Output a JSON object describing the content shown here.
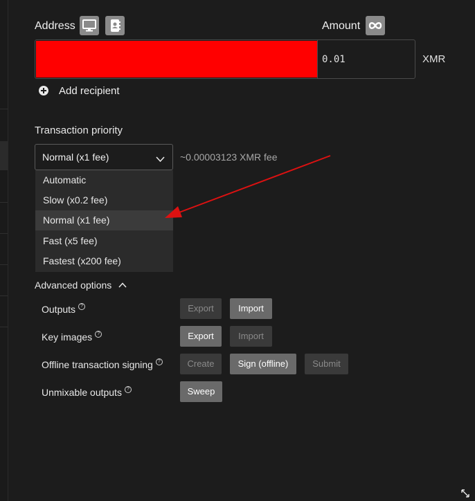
{
  "address": {
    "label": "Address",
    "icons": [
      "monitor-icon",
      "address-book-icon"
    ]
  },
  "amount": {
    "label": "Amount",
    "icon": "infinity-icon",
    "value": "0.01",
    "unit": "XMR"
  },
  "recipients": {
    "add_label": "Add recipient"
  },
  "priority": {
    "label": "Transaction priority",
    "selected": "Normal (x1 fee)",
    "fee": "~0.00003123 XMR fee",
    "options": [
      "Automatic",
      "Slow (x0.2 fee)",
      "Normal (x1 fee)",
      "Fast (x5 fee)",
      "Fastest (x200 fee)"
    ]
  },
  "advanced": {
    "label": "Advanced options",
    "rows": [
      {
        "label": "Outputs",
        "buttons": [
          {
            "label": "Export",
            "enabled": false
          },
          {
            "label": "Import",
            "enabled": true
          }
        ]
      },
      {
        "label": "Key images",
        "buttons": [
          {
            "label": "Export",
            "enabled": true
          },
          {
            "label": "Import",
            "enabled": false
          }
        ]
      },
      {
        "label": "Offline transaction signing",
        "buttons": [
          {
            "label": "Create",
            "enabled": false
          },
          {
            "label": "Sign (offline)",
            "enabled": true
          },
          {
            "label": "Submit",
            "enabled": false
          }
        ]
      },
      {
        "label": "Unmixable outputs",
        "buttons": [
          {
            "label": "Sweep",
            "enabled": true
          }
        ]
      }
    ]
  },
  "colors": {
    "background": "#1c1c1c",
    "redacted": "#ff0000",
    "annotation_arrow": "#dd1111",
    "button_enabled": "#6a6a6a",
    "button_disabled": "#3a3a3a"
  }
}
